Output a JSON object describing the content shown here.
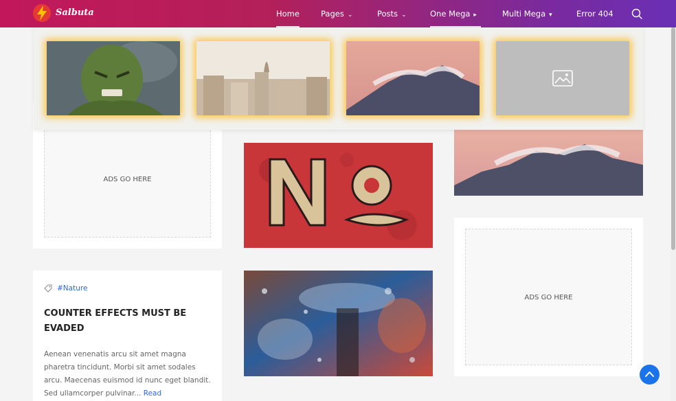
{
  "brand": {
    "name": "Salbuta"
  },
  "nav": {
    "items": [
      {
        "label": "Home",
        "chevron": ""
      },
      {
        "label": "Pages",
        "chevron": "chevron-down-icon"
      },
      {
        "label": "Posts",
        "chevron": "chevron-down-icon"
      },
      {
        "label": "One Mega",
        "chevron": "caret-right-icon"
      },
      {
        "label": "Multi Mega",
        "chevron": "caret-down-icon"
      },
      {
        "label": "Error 404",
        "chevron": ""
      }
    ],
    "search_icon": "search-icon"
  },
  "mega_menu": {
    "thumbnails": [
      "hulk-portrait",
      "city-rooftops",
      "mountain-sunset",
      "image-placeholder-icon"
    ]
  },
  "ads": {
    "label": "ADS GO HERE"
  },
  "post": {
    "tag": "#Nature",
    "title": "COUNTER EFFECTS MUST BE EVADED",
    "excerpt": "Aenean venenatis arcu sit amet magna pharetra tincidunt. Morbi sit amet sodales arcu. Maecenas euismod id nunc eget blandit. Sed ullamcorper pulvinar...",
    "read_more": "Read"
  },
  "colors": {
    "accent": "#c2185b",
    "link": "#2e6bd1",
    "back_to_top": "#1a73e8"
  }
}
